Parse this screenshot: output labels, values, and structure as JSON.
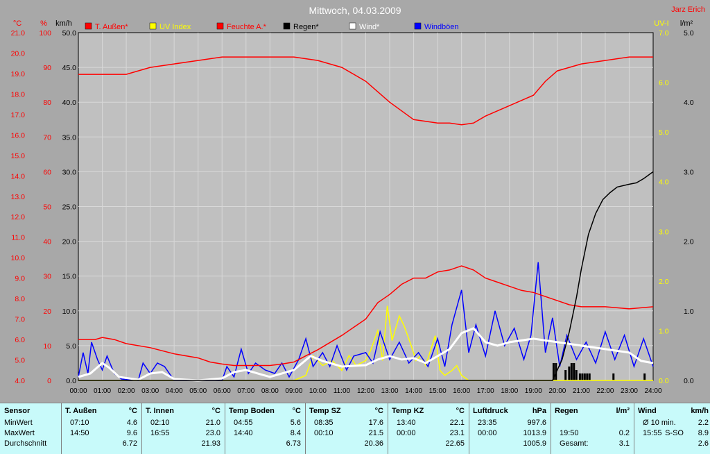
{
  "header": {
    "title": "Mittwoch, 04.03.2009",
    "author": "Jarz Erich"
  },
  "colors": {
    "background": "#a8a8a8",
    "temp": "#ff0000",
    "uv": "#ffff00",
    "humidity": "#ff0000",
    "rain": "#000000",
    "wind": "#ffffff",
    "gusts": "#0000ff",
    "stats_bg": "#c8fafa"
  },
  "chart_data": {
    "type": "line",
    "x_ticks": [
      "00:00",
      "01:00",
      "02:00",
      "03:00",
      "04:00",
      "05:00",
      "06:00",
      "07:00",
      "08:00",
      "09:00",
      "10:00",
      "11:00",
      "12:00",
      "13:00",
      "14:00",
      "15:00",
      "16:00",
      "17:00",
      "18:00",
      "19:00",
      "20:00",
      "21:00",
      "22:00",
      "23:00",
      "24:00"
    ],
    "axes": {
      "temp": {
        "label": "°C",
        "min": 4.0,
        "max": 21.0,
        "ticks": [
          "21.0",
          "20.0",
          "19.0",
          "18.0",
          "17.0",
          "16.0",
          "15.0",
          "14.0",
          "13.0",
          "12.0",
          "11.0",
          "10.0",
          "9.0",
          "8.0",
          "7.0",
          "6.0",
          "5.0",
          "4.0"
        ]
      },
      "humidity": {
        "label": "%",
        "min": 0,
        "max": 100,
        "ticks": [
          "100",
          "90",
          "80",
          "70",
          "60",
          "50",
          "40",
          "30",
          "20",
          "10",
          "0"
        ]
      },
      "wind": {
        "label": "km/h",
        "min": 0,
        "max": 50,
        "ticks": [
          "50.0",
          "45.0",
          "40.0",
          "35.0",
          "30.0",
          "25.0",
          "20.0",
          "15.0",
          "10.0",
          "5.0",
          "0.0"
        ]
      },
      "uv": {
        "label": "UV-I",
        "min": 0,
        "max": 7,
        "ticks": [
          "7.0",
          "6.0",
          "5.0",
          "4.0",
          "3.0",
          "2.0",
          "1.0",
          "0.0"
        ]
      },
      "rain": {
        "label": "l/m²",
        "min": 0,
        "max": 5,
        "ticks": [
          "5.0",
          "4.0",
          "3.0",
          "2.0",
          "1.0",
          "0.0"
        ]
      }
    },
    "legend": [
      "T. Außen*",
      "UV Index",
      "Feuchte A.*",
      "Regen*",
      "Wind*",
      "Windböen"
    ],
    "series": [
      {
        "name": "T. Außen*",
        "axis": "temp",
        "color": "#ff0000",
        "points": [
          [
            0,
            6.0
          ],
          [
            0.7,
            6.0
          ],
          [
            1.0,
            6.1
          ],
          [
            1.5,
            6.0
          ],
          [
            2.0,
            5.8
          ],
          [
            3.0,
            5.6
          ],
          [
            4.0,
            5.3
          ],
          [
            5.0,
            5.1
          ],
          [
            5.5,
            4.9
          ],
          [
            6.0,
            4.8
          ],
          [
            6.5,
            4.73
          ],
          [
            7.0,
            4.73
          ],
          [
            8.0,
            4.73
          ],
          [
            8.5,
            4.8
          ],
          [
            9.0,
            4.9
          ],
          [
            9.5,
            5.2
          ],
          [
            10.0,
            5.5
          ],
          [
            11.0,
            6.2
          ],
          [
            12.0,
            7.0
          ],
          [
            12.5,
            7.8
          ],
          [
            13.0,
            8.2
          ],
          [
            13.5,
            8.7
          ],
          [
            14.0,
            9.0
          ],
          [
            14.5,
            9.0
          ],
          [
            15.0,
            9.3
          ],
          [
            15.5,
            9.4
          ],
          [
            16.0,
            9.6
          ],
          [
            16.5,
            9.4
          ],
          [
            17.0,
            9.0
          ],
          [
            17.5,
            8.8
          ],
          [
            18.0,
            8.6
          ],
          [
            18.5,
            8.4
          ],
          [
            19.0,
            8.3
          ],
          [
            19.5,
            8.1
          ],
          [
            20.0,
            7.9
          ],
          [
            20.5,
            7.7
          ],
          [
            21.0,
            7.6
          ],
          [
            22.0,
            7.6
          ],
          [
            23.0,
            7.5
          ],
          [
            24.0,
            7.6
          ]
        ]
      },
      {
        "name": "Feuchte A.*",
        "axis": "humidity",
        "color": "#ff0000",
        "points": [
          [
            0,
            88
          ],
          [
            1.0,
            88
          ],
          [
            2.0,
            88
          ],
          [
            3.0,
            90
          ],
          [
            4.0,
            91
          ],
          [
            5.0,
            92
          ],
          [
            6.0,
            93
          ],
          [
            7.0,
            93
          ],
          [
            8.0,
            93
          ],
          [
            9.0,
            93
          ],
          [
            10.0,
            92
          ],
          [
            11.0,
            90
          ],
          [
            12.0,
            86
          ],
          [
            13.0,
            80
          ],
          [
            14.0,
            75
          ],
          [
            15.0,
            74
          ],
          [
            15.5,
            74
          ],
          [
            16.0,
            73.5
          ],
          [
            16.5,
            74
          ],
          [
            17.0,
            76
          ],
          [
            18.0,
            79
          ],
          [
            19.0,
            82
          ],
          [
            19.5,
            86
          ],
          [
            20.0,
            89
          ],
          [
            21.0,
            91
          ],
          [
            22.0,
            92
          ],
          [
            23.0,
            93
          ],
          [
            24.0,
            93
          ]
        ]
      },
      {
        "name": "UV Index",
        "axis": "uv",
        "color": "#ffff00",
        "points": [
          [
            0,
            0
          ],
          [
            9.0,
            0
          ],
          [
            9.5,
            0.1
          ],
          [
            9.8,
            0.5
          ],
          [
            10.2,
            0.3
          ],
          [
            10.6,
            0.4
          ],
          [
            11.0,
            0.2
          ],
          [
            11.3,
            0.5
          ],
          [
            11.6,
            0.3
          ],
          [
            12.0,
            0.4
          ],
          [
            12.2,
            0.6
          ],
          [
            12.5,
            1.0
          ],
          [
            12.7,
            0.4
          ],
          [
            12.9,
            1.5
          ],
          [
            13.1,
            0.8
          ],
          [
            13.4,
            1.3
          ],
          [
            13.6,
            1.1
          ],
          [
            13.9,
            0.7
          ],
          [
            14.1,
            0.4
          ],
          [
            14.3,
            0.5
          ],
          [
            14.5,
            0.3
          ],
          [
            14.7,
            0.6
          ],
          [
            14.9,
            0.9
          ],
          [
            15.1,
            0.2
          ],
          [
            15.3,
            0.1
          ],
          [
            15.6,
            0.2
          ],
          [
            15.8,
            0.3
          ],
          [
            16.0,
            0.1
          ],
          [
            16.3,
            0.0
          ],
          [
            24,
            0
          ]
        ]
      },
      {
        "name": "Regen*",
        "axis": "rain",
        "color": "#000000",
        "points": [
          [
            0,
            0
          ],
          [
            19.8,
            0
          ],
          [
            20.2,
            0.3
          ],
          [
            20.5,
            0.7
          ],
          [
            20.8,
            1.2
          ],
          [
            21.0,
            1.6
          ],
          [
            21.3,
            2.1
          ],
          [
            21.6,
            2.4
          ],
          [
            21.9,
            2.6
          ],
          [
            22.2,
            2.7
          ],
          [
            22.5,
            2.78
          ],
          [
            23.0,
            2.82
          ],
          [
            23.3,
            2.84
          ],
          [
            23.6,
            2.9
          ],
          [
            24.0,
            3.0
          ]
        ]
      },
      {
        "name": "Wind*",
        "axis": "wind",
        "color": "#ffffff",
        "points": [
          [
            0,
            0.5
          ],
          [
            0.5,
            1.0
          ],
          [
            1.0,
            2.5
          ],
          [
            1.3,
            1.8
          ],
          [
            1.7,
            0.5
          ],
          [
            2.5,
            0.1
          ],
          [
            3.0,
            1.0
          ],
          [
            3.5,
            1.2
          ],
          [
            4.0,
            0.2
          ],
          [
            5.0,
            0.0
          ],
          [
            6.0,
            0.3
          ],
          [
            6.5,
            1.2
          ],
          [
            7.0,
            1.5
          ],
          [
            8.0,
            0.5
          ],
          [
            9.0,
            1.5
          ],
          [
            9.7,
            3.5
          ],
          [
            10.2,
            2.8
          ],
          [
            11.0,
            2.0
          ],
          [
            12.0,
            2.2
          ],
          [
            12.5,
            3.0
          ],
          [
            13.0,
            3.5
          ],
          [
            13.5,
            3.0
          ],
          [
            14.0,
            3.2
          ],
          [
            14.5,
            2.5
          ],
          [
            15.0,
            3.5
          ],
          [
            15.5,
            4.5
          ],
          [
            16.0,
            6.8
          ],
          [
            16.5,
            7.5
          ],
          [
            17.0,
            5.5
          ],
          [
            17.5,
            5.0
          ],
          [
            18.0,
            5.5
          ],
          [
            19.0,
            6.0
          ],
          [
            20.0,
            5.5
          ],
          [
            21.0,
            5.0
          ],
          [
            22.0,
            4.5
          ],
          [
            23.0,
            4.0
          ],
          [
            23.5,
            2.8
          ],
          [
            24.0,
            2.5
          ]
        ]
      },
      {
        "name": "Windböen",
        "axis": "wind",
        "color": "#0000ff",
        "points": [
          [
            0,
            0.5
          ],
          [
            0.2,
            4.0
          ],
          [
            0.4,
            1.0
          ],
          [
            0.55,
            5.5
          ],
          [
            0.8,
            3.0
          ],
          [
            1.0,
            1.5
          ],
          [
            1.2,
            3.5
          ],
          [
            1.5,
            1.0
          ],
          [
            1.8,
            0.2
          ],
          [
            2.5,
            0.0
          ],
          [
            2.7,
            2.5
          ],
          [
            3.0,
            1.0
          ],
          [
            3.3,
            2.5
          ],
          [
            3.6,
            2.0
          ],
          [
            4.0,
            0.0
          ],
          [
            6.0,
            0.0
          ],
          [
            6.2,
            2.0
          ],
          [
            6.5,
            0.5
          ],
          [
            6.8,
            4.5
          ],
          [
            7.1,
            1.0
          ],
          [
            7.4,
            2.5
          ],
          [
            7.8,
            1.5
          ],
          [
            8.2,
            1.0
          ],
          [
            8.5,
            2.5
          ],
          [
            8.8,
            0.5
          ],
          [
            9.2,
            3.0
          ],
          [
            9.5,
            6.0
          ],
          [
            9.8,
            2.0
          ],
          [
            10.2,
            4.0
          ],
          [
            10.5,
            2.0
          ],
          [
            10.8,
            5.0
          ],
          [
            11.2,
            1.5
          ],
          [
            11.5,
            3.5
          ],
          [
            12.0,
            4.0
          ],
          [
            12.3,
            2.5
          ],
          [
            12.6,
            7.0
          ],
          [
            13.0,
            3.0
          ],
          [
            13.4,
            5.5
          ],
          [
            13.8,
            2.5
          ],
          [
            14.2,
            4.0
          ],
          [
            14.6,
            2.0
          ],
          [
            15.0,
            6.0
          ],
          [
            15.3,
            2.0
          ],
          [
            15.6,
            8.0
          ],
          [
            16.0,
            13.0
          ],
          [
            16.3,
            4.0
          ],
          [
            16.6,
            8.0
          ],
          [
            17.0,
            3.5
          ],
          [
            17.4,
            10.0
          ],
          [
            17.8,
            5.0
          ],
          [
            18.2,
            7.5
          ],
          [
            18.6,
            3.0
          ],
          [
            18.9,
            6.5
          ],
          [
            19.2,
            17.0
          ],
          [
            19.5,
            4.0
          ],
          [
            19.8,
            9.0
          ],
          [
            20.1,
            2.0
          ],
          [
            20.4,
            6.5
          ],
          [
            20.8,
            3.0
          ],
          [
            21.2,
            5.5
          ],
          [
            21.6,
            2.5
          ],
          [
            22.0,
            7.0
          ],
          [
            22.4,
            3.0
          ],
          [
            22.8,
            6.5
          ],
          [
            23.2,
            2.0
          ],
          [
            23.6,
            6.0
          ],
          [
            24.0,
            2.0
          ]
        ]
      }
    ],
    "rain_bars": [
      [
        19.8,
        0.25
      ],
      [
        19.9,
        0.25
      ],
      [
        20.3,
        0.15
      ],
      [
        20.45,
        0.2
      ],
      [
        20.55,
        0.25
      ],
      [
        20.65,
        0.25
      ],
      [
        20.75,
        0.15
      ],
      [
        20.9,
        0.1
      ],
      [
        21.0,
        0.1
      ],
      [
        21.1,
        0.1
      ],
      [
        21.2,
        0.1
      ],
      [
        21.3,
        0.1
      ],
      [
        22.3,
        0.1
      ],
      [
        23.6,
        0.1
      ]
    ]
  },
  "stats": {
    "columns": [
      {
        "header": [
          "Sensor",
          "",
          ""
        ],
        "rows": [
          [
            "MinWert",
            "",
            ""
          ],
          [
            "MaxWert",
            "",
            ""
          ],
          [
            "Durchschnitt",
            "",
            ""
          ]
        ]
      },
      {
        "header": [
          "T. Außen",
          "",
          "°C"
        ],
        "rows": [
          [
            "07:10",
            "",
            "4.6"
          ],
          [
            "14:50",
            "",
            "9.6"
          ],
          [
            "",
            "",
            "6.72"
          ]
        ]
      },
      {
        "header": [
          "T. Innen",
          "",
          "°C"
        ],
        "rows": [
          [
            "02:10",
            "",
            "21.0"
          ],
          [
            "16:55",
            "",
            "23.0"
          ],
          [
            "",
            "",
            "21.93"
          ]
        ]
      },
      {
        "header": [
          "Temp Boden",
          "",
          "°C"
        ],
        "rows": [
          [
            "04:55",
            "",
            "5.6"
          ],
          [
            "14:40",
            "",
            "8.4"
          ],
          [
            "",
            "",
            "6.73"
          ]
        ]
      },
      {
        "header": [
          "Temp SZ",
          "",
          "°C"
        ],
        "rows": [
          [
            "08:35",
            "",
            "17.6"
          ],
          [
            "00:10",
            "",
            "21.5"
          ],
          [
            "",
            "",
            "20.36"
          ]
        ]
      },
      {
        "header": [
          "Temp KZ",
          "",
          "°C"
        ],
        "rows": [
          [
            "13:40",
            "",
            "22.1"
          ],
          [
            "00:00",
            "",
            "23.1"
          ],
          [
            "",
            "",
            "22.65"
          ]
        ]
      },
      {
        "header": [
          "Luftdruck",
          "",
          "hPa"
        ],
        "rows": [
          [
            "23:35",
            "",
            "997.6"
          ],
          [
            "00:00",
            "",
            "1013.9"
          ],
          [
            "",
            "",
            "1005.9"
          ]
        ]
      },
      {
        "header": [
          "Regen",
          "",
          "l/m²"
        ],
        "rows": [
          [
            "",
            "",
            ""
          ],
          [
            "19:50",
            "",
            "0.2"
          ],
          [
            "Gesamt:",
            "",
            "3.1"
          ]
        ]
      },
      {
        "header": [
          "Wind",
          "",
          "km/h"
        ],
        "rows": [
          [
            "Ø 10 min.",
            "",
            "2.2"
          ],
          [
            "15:55",
            "S-SO",
            "8.9"
          ],
          [
            "",
            "",
            "2.6"
          ]
        ]
      }
    ]
  }
}
